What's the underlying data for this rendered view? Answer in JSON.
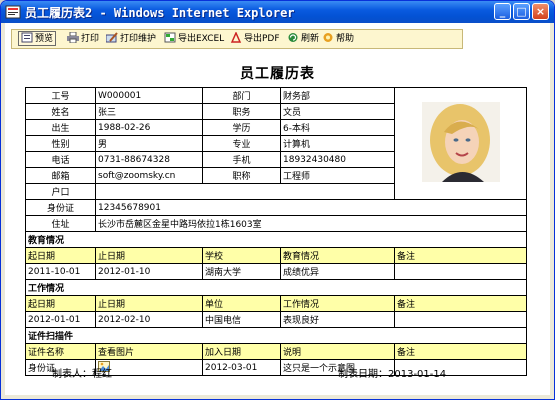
{
  "window": {
    "title": "员工履历表2 - Windows Internet Explorer",
    "minimize": "_",
    "maximize": "□",
    "close": "×"
  },
  "toolbar": {
    "preview": "预览",
    "print": "打印",
    "print_setup": "打印维护",
    "export_excel": "导出EXCEL",
    "export_pdf": "导出PDF",
    "refresh": "刷新",
    "help": "帮助"
  },
  "doc_title": "员工履历表",
  "basic": {
    "labels": {
      "id": "工号",
      "name": "姓名",
      "birth": "出生",
      "gender": "性别",
      "phone": "电话",
      "email": "邮箱",
      "hukou": "户口",
      "idcard": "身份证",
      "address": "住址",
      "dept": "部门",
      "post": "职务",
      "edu": "学历",
      "major": "专业",
      "mobile": "手机",
      "title": "职称"
    },
    "values": {
      "id": "W000001",
      "name": "张三",
      "birth": "1988-02-26",
      "gender": "男",
      "phone": "0731-88674328",
      "email": "soft@zoomsky.cn",
      "hukou": "",
      "idcard": "12345678901",
      "address": "长沙市岳麓区金星中路玛依拉1栋1603室",
      "dept": "财务部",
      "post": "文员",
      "edu": "6-本科",
      "major": "计算机",
      "mobile": "18932430480",
      "title": "工程师"
    }
  },
  "education": {
    "section": "教育情况",
    "headers": [
      "起日期",
      "止日期",
      "学校",
      "教育情况",
      "备注"
    ],
    "rows": [
      [
        "2011-10-01",
        "2012-01-10",
        "湖南大学",
        "成绩优异",
        ""
      ]
    ]
  },
  "work": {
    "section": "工作情况",
    "headers": [
      "起日期",
      "止日期",
      "单位",
      "工作情况",
      "备注"
    ],
    "rows": [
      [
        "2012-01-01",
        "2012-02-10",
        "中国电信",
        "表现良好",
        ""
      ]
    ]
  },
  "attachments": {
    "section": "证件扫描件",
    "headers": [
      "证件名称",
      "查看图片",
      "加入日期",
      "说明",
      "备注"
    ],
    "rows": [
      [
        "身份证",
        "",
        "2012-03-01",
        "这只是一个示意图",
        ""
      ]
    ]
  },
  "footer": {
    "maker_label": "制表人：",
    "maker": "程红",
    "date_label": "制表日期：",
    "date": "2013-01-14"
  }
}
